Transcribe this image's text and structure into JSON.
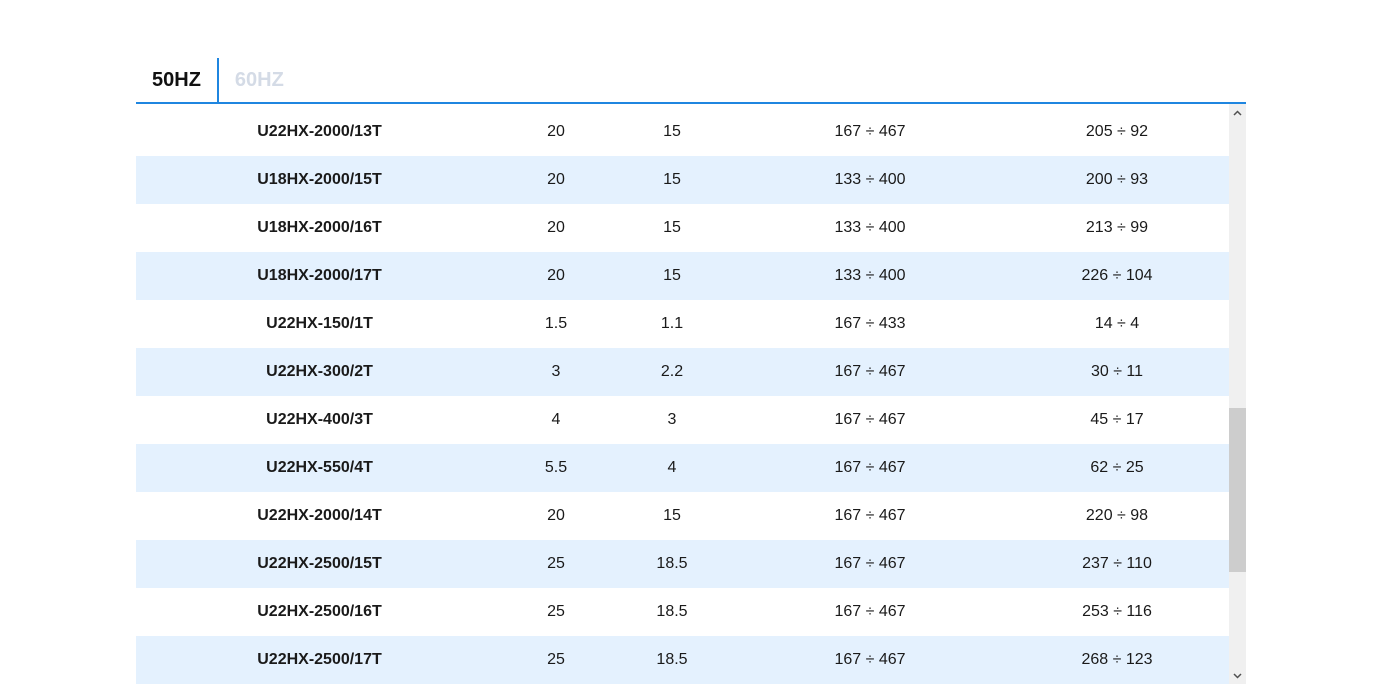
{
  "tabs": [
    {
      "label": "50HZ",
      "active": true
    },
    {
      "label": "60HZ",
      "active": false
    }
  ],
  "scroll": {
    "position_fraction": 0.75,
    "visible_fraction": 0.3
  },
  "colors": {
    "accent": "#1f86e0",
    "row_stripe": "#e4f1fe",
    "inactive_tab": "#d4dbe6"
  },
  "rows": [
    [
      "U22HX-2000/13T",
      "20",
      "15",
      "167 ÷ 467",
      "205 ÷ 92"
    ],
    [
      "U18HX-2000/15T",
      "20",
      "15",
      "133 ÷ 400",
      "200 ÷ 93"
    ],
    [
      "U18HX-2000/16T",
      "20",
      "15",
      "133 ÷ 400",
      "213 ÷ 99"
    ],
    [
      "U18HX-2000/17T",
      "20",
      "15",
      "133 ÷ 400",
      "226 ÷ 104"
    ],
    [
      "U22HX-150/1T",
      "1.5",
      "1.1",
      "167 ÷ 433",
      "14 ÷ 4"
    ],
    [
      "U22HX-300/2T",
      "3",
      "2.2",
      "167 ÷ 467",
      "30 ÷ 11"
    ],
    [
      "U22HX-400/3T",
      "4",
      "3",
      "167 ÷ 467",
      "45 ÷ 17"
    ],
    [
      "U22HX-550/4T",
      "5.5",
      "4",
      "167 ÷ 467",
      "62 ÷ 25"
    ],
    [
      "U22HX-2000/14T",
      "20",
      "15",
      "167 ÷ 467",
      "220 ÷ 98"
    ],
    [
      "U22HX-2500/15T",
      "25",
      "18.5",
      "167 ÷ 467",
      "237 ÷ 110"
    ],
    [
      "U22HX-2500/16T",
      "25",
      "18.5",
      "167 ÷ 467",
      "253 ÷ 116"
    ],
    [
      "U22HX-2500/17T",
      "25",
      "18.5",
      "167 ÷ 467",
      "268 ÷ 123"
    ]
  ]
}
